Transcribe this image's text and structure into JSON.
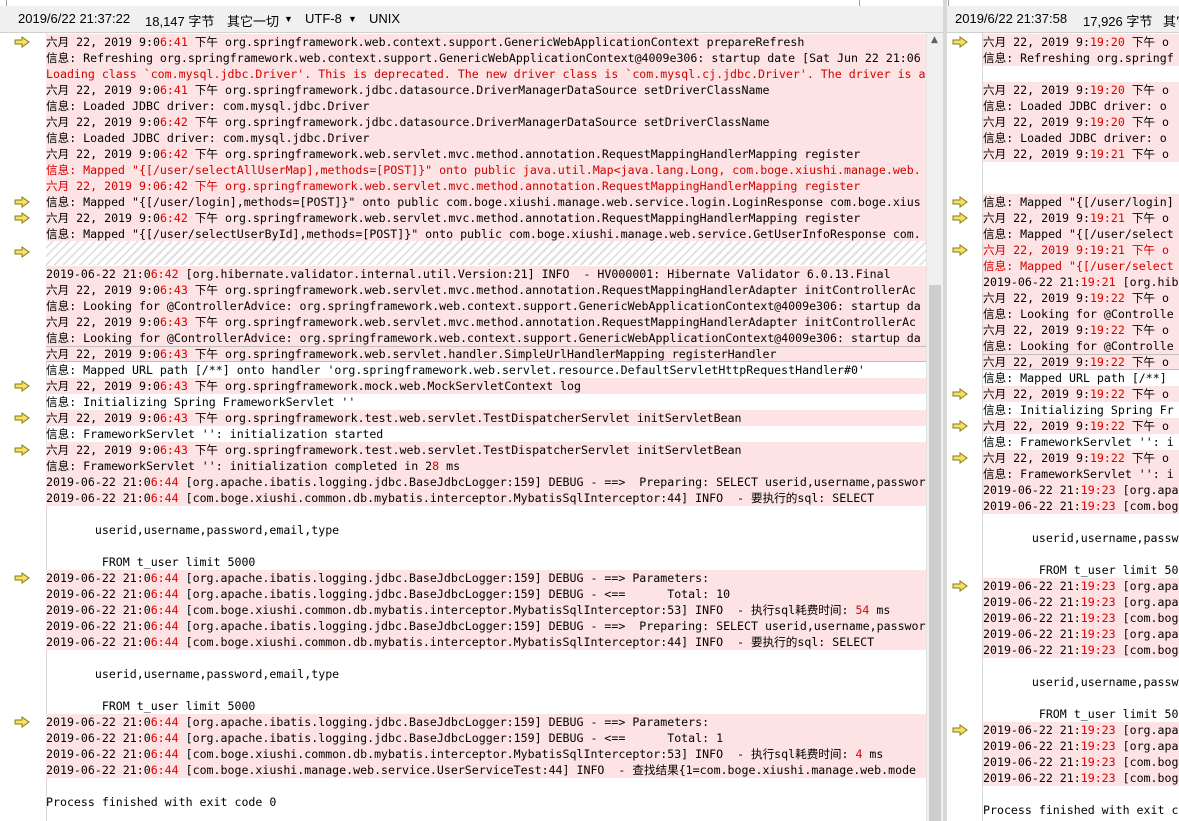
{
  "left": {
    "status": {
      "datetime": "2019/6/22 21:37:22",
      "size": "18,147 字节",
      "format": "其它一切",
      "encoding": "UTF-8",
      "eol": "UNIX"
    },
    "lines": [
      {
        "pre": "六月 22, 2019 9:0",
        "hl": "6:41",
        "post": " 下午 org.springframework.web.context.support.GenericWebApplicationContext prepareRefresh",
        "red": false,
        "arrow": true
      },
      {
        "pre": "信息: Refreshing org.springframework.web.context.support.GenericWebApplicationContext@4009e306: startup date [Sat Jun 22 21:06",
        "hl": "",
        "post": "",
        "red": false,
        "arrow": false
      },
      {
        "pre": "Loading class `com.mysql.jdbc.Driver'. This is deprecated. The new driver class is `com.mysql.cj.jdbc.Driver'. The driver is a",
        "hl": "",
        "post": "",
        "red": true,
        "arrow": false
      },
      {
        "pre": "六月 22, 2019 9:0",
        "hl": "6:41",
        "post": " 下午 org.springframework.jdbc.datasource.DriverManagerDataSource setDriverClassName",
        "red": false,
        "arrow": false
      },
      {
        "pre": "信息: Loaded JDBC driver: com.mysql.jdbc.Driver",
        "hl": "",
        "post": "",
        "red": false,
        "arrow": false
      },
      {
        "pre": "六月 22, 2019 9:0",
        "hl": "6:42",
        "post": " 下午 org.springframework.jdbc.datasource.DriverManagerDataSource setDriverClassName",
        "red": false,
        "arrow": false
      },
      {
        "pre": "信息: Loaded JDBC driver: com.mysql.jdbc.Driver",
        "hl": "",
        "post": "",
        "red": false,
        "arrow": false
      },
      {
        "pre": "六月 22, 2019 9:0",
        "hl": "6:42",
        "post": " 下午 org.springframework.web.servlet.mvc.method.annotation.RequestMappingHandlerMapping register",
        "red": false,
        "arrow": false
      },
      {
        "pre": "信息: Mapped \"{[/user/selectAllUserMap],methods=[POST]}\" onto public java.util.Map<java.lang.Long, com.boge.xiushi.manage.web.",
        "hl": "",
        "post": "",
        "red": true,
        "arrow": false
      },
      {
        "pre": "六月 22, 2019 9:06:42 下午 org.springframework.web.servlet.mvc.method.annotation.RequestMappingHandlerMapping register",
        "hl": "",
        "post": "",
        "red": true,
        "arrow": false
      },
      {
        "pre": "信息: Mapped \"{[/user/login],methods=[POST]}\" onto public com.boge.xiushi.manage.web.service.login.LoginResponse com.boge.xius",
        "hl": "",
        "post": "",
        "red": false,
        "arrow": true
      },
      {
        "pre": "六月 22, 2019 9:0",
        "hl": "6:42",
        "post": " 下午 org.springframework.web.servlet.mvc.method.annotation.RequestMappingHandlerMapping register",
        "red": false,
        "arrow": true
      },
      {
        "pre": "信息: Mapped \"{[/user/selectUserById],methods=[POST]}\" onto public com.boge.xiushi.manage.web.service.GetUserInfoResponse com.",
        "hl": "",
        "post": "",
        "red": false,
        "arrow": false
      },
      {
        "pre": "",
        "hl": "",
        "post": "",
        "red": false,
        "arrow": true,
        "hatch": true
      },
      {
        "pre": "2019-06-22 21:0",
        "hl": "6:42",
        "post": " [org.hibernate.validator.internal.util.Version:21] INFO  - HV000001: Hibernate Validator 6.0.13.Final",
        "red": false,
        "arrow": false
      },
      {
        "pre": "六月 22, 2019 9:0",
        "hl": "6:43",
        "post": " 下午 org.springframework.web.servlet.mvc.method.annotation.RequestMappingHandlerAdapter initControllerAc",
        "red": false,
        "arrow": false
      },
      {
        "pre": "信息: Looking for @ControllerAdvice: org.springframework.web.context.support.GenericWebApplicationContext@4009e306: startup da",
        "hl": "",
        "post": "",
        "red": false,
        "arrow": false
      },
      {
        "pre": "六月 22, 2019 9:0",
        "hl": "6:43",
        "post": " 下午 org.springframework.web.servlet.mvc.method.annotation.RequestMappingHandlerAdapter initControllerAc",
        "red": false,
        "arrow": false
      },
      {
        "pre": "信息: Looking for @ControllerAdvice: org.springframework.web.context.support.GenericWebApplicationContext@4009e306: startup da",
        "hl": "",
        "post": "",
        "red": false,
        "arrow": false
      },
      {
        "pre": "六月 22, 2019 9:0",
        "hl": "6:43",
        "post": " 下午 org.springframework.web.servlet.handler.SimpleUrlHandlerMapping registerHandler",
        "red": false,
        "arrow": false,
        "box": true
      },
      {
        "pre": "信息: Mapped URL path [/**] onto handler 'org.springframework.web.servlet.resource.DefaultServletHttpRequestHandler#0'",
        "hl": "",
        "post": "",
        "red": false,
        "arrow": false,
        "plain": true
      },
      {
        "pre": "六月 22, 2019 9:0",
        "hl": "6:43",
        "post": " 下午 org.springframework.mock.web.MockServletContext log",
        "red": false,
        "arrow": true
      },
      {
        "pre": "信息: Initializing Spring FrameworkServlet ''",
        "hl": "",
        "post": "",
        "red": false,
        "arrow": false,
        "plain": true
      },
      {
        "pre": "六月 22, 2019 9:0",
        "hl": "6:43",
        "post": " 下午 org.springframework.test.web.servlet.TestDispatcherServlet initServletBean",
        "red": false,
        "arrow": true
      },
      {
        "pre": "信息: FrameworkServlet '': initialization started",
        "hl": "",
        "post": "",
        "red": false,
        "arrow": false,
        "plain": true
      },
      {
        "pre": "六月 22, 2019 9:0",
        "hl": "6:43",
        "post": " 下午 org.springframework.test.web.servlet.TestDispatcherServlet initServletBean",
        "red": false,
        "arrow": true
      },
      {
        "pre": "信息: FrameworkServlet '': initialization completed in 2",
        "hl": "8",
        "post": " ms",
        "red": false,
        "arrow": false
      },
      {
        "pre": "2019-06-22 21:0",
        "hl": "6:44",
        "post": " [org.apache.ibatis.logging.jdbc.BaseJdbcLogger:159] DEBUG - ==>  Preparing: SELECT userid,username,passwor",
        "red": false,
        "arrow": false
      },
      {
        "pre": "2019-06-22 21:0",
        "hl": "6:44",
        "post": " [com.boge.xiushi.common.db.mybatis.interceptor.MybatisSqlInterceptor:44] INFO  - 要执行的sql: SELECT",
        "red": false,
        "arrow": false
      },
      {
        "pre": "",
        "hl": "",
        "post": "",
        "red": false,
        "arrow": false,
        "plain": true
      },
      {
        "pre": "       userid,username,password,email,type",
        "hl": "",
        "post": "",
        "red": false,
        "arrow": false,
        "plain": true
      },
      {
        "pre": "",
        "hl": "",
        "post": "",
        "red": false,
        "arrow": false,
        "plain": true
      },
      {
        "pre": "        FROM t_user limit 5000",
        "hl": "",
        "post": "",
        "red": false,
        "arrow": false,
        "plain": true
      },
      {
        "pre": "2019-06-22 21:0",
        "hl": "6:44",
        "post": " [org.apache.ibatis.logging.jdbc.BaseJdbcLogger:159] DEBUG - ==> Parameters: ",
        "red": false,
        "arrow": true
      },
      {
        "pre": "2019-06-22 21:0",
        "hl": "6:44",
        "post": " [org.apache.ibatis.logging.jdbc.BaseJdbcLogger:159] DEBUG - <==      Total: 10",
        "red": false,
        "arrow": false
      },
      {
        "pre": "2019-06-22 21:0",
        "hl": "6:44",
        "post": " [com.boge.xiushi.common.db.mybatis.interceptor.MybatisSqlInterceptor:53] INFO  - 执行sql耗费时间: ",
        "hl2": "54",
        "post2": " ms",
        "red": false,
        "arrow": false
      },
      {
        "pre": "2019-06-22 21:0",
        "hl": "6:44",
        "post": " [org.apache.ibatis.logging.jdbc.BaseJdbcLogger:159] DEBUG - ==>  Preparing: SELECT userid,username,passwor",
        "red": false,
        "arrow": false
      },
      {
        "pre": "2019-06-22 21:0",
        "hl": "6:44",
        "post": " [com.boge.xiushi.common.db.mybatis.interceptor.MybatisSqlInterceptor:44] INFO  - 要执行的sql: SELECT",
        "red": false,
        "arrow": false
      },
      {
        "pre": "",
        "hl": "",
        "post": "",
        "red": false,
        "arrow": false,
        "plain": true
      },
      {
        "pre": "       userid,username,password,email,type",
        "hl": "",
        "post": "",
        "red": false,
        "arrow": false,
        "plain": true
      },
      {
        "pre": "",
        "hl": "",
        "post": "",
        "red": false,
        "arrow": false,
        "plain": true
      },
      {
        "pre": "        FROM t_user limit 5000",
        "hl": "",
        "post": "",
        "red": false,
        "arrow": false,
        "plain": true
      },
      {
        "pre": "2019-06-22 21:0",
        "hl": "6:44",
        "post": " [org.apache.ibatis.logging.jdbc.BaseJdbcLogger:159] DEBUG - ==> Parameters: ",
        "red": false,
        "arrow": true
      },
      {
        "pre": "2019-06-22 21:0",
        "hl": "6:44",
        "post": " [org.apache.ibatis.logging.jdbc.BaseJdbcLogger:159] DEBUG - <==      Total: 1",
        "red": false,
        "arrow": false
      },
      {
        "pre": "2019-06-22 21:0",
        "hl": "6:44",
        "post": " [com.boge.xiushi.common.db.mybatis.interceptor.MybatisSqlInterceptor:53] INFO  - 执行sql耗费时间: ",
        "hl2": "4",
        "post2": " ms",
        "red": false,
        "arrow": false
      },
      {
        "pre": "2019-06-22 21:0",
        "hl": "6:44",
        "post": " [com.boge.xiushi.manage.web.service.UserServiceTest:44] INFO  - 查找结果{1=com.boge.xiushi.manage.web.mode",
        "red": false,
        "arrow": false
      },
      {
        "pre": "",
        "hl": "",
        "post": "",
        "red": false,
        "arrow": false,
        "plain": true
      },
      {
        "pre": "Process finished with exit code 0",
        "hl": "",
        "post": "",
        "red": false,
        "arrow": false,
        "plain": true
      }
    ]
  },
  "right": {
    "status": {
      "datetime": "2019/6/22 21:37:58",
      "size": "17,926 字节",
      "format": "其它"
    },
    "lines": [
      {
        "pre": "六月 22, 2019 9:",
        "hl": "19:20",
        "post": " 下午 o",
        "red": false,
        "arrow": true
      },
      {
        "pre": "信息: Refreshing org.springf",
        "hl": "",
        "post": "",
        "red": false,
        "arrow": false
      },
      {
        "pre": "",
        "hl": "",
        "post": "",
        "red": false,
        "arrow": false,
        "plain": true
      },
      {
        "pre": "六月 22, 2019 9:",
        "hl": "19:20",
        "post": " 下午 o",
        "red": false,
        "arrow": false
      },
      {
        "pre": "信息: Loaded JDBC driver: o",
        "hl": "",
        "post": "",
        "red": false,
        "arrow": false
      },
      {
        "pre": "六月 22, 2019 9:",
        "hl": "19:20",
        "post": " 下午 o",
        "red": false,
        "arrow": false
      },
      {
        "pre": "信息: Loaded JDBC driver: o",
        "hl": "",
        "post": "",
        "red": false,
        "arrow": false
      },
      {
        "pre": "六月 22, 2019 9:",
        "hl": "19:21",
        "post": " 下午 o",
        "red": false,
        "arrow": false
      },
      {
        "pre": "",
        "hl": "",
        "post": "",
        "red": false,
        "arrow": false,
        "hatch2": true
      },
      {
        "pre": "",
        "hl": "",
        "post": "",
        "red": false,
        "arrow": false,
        "hatch2": true
      },
      {
        "pre": "信息: Mapped \"{[/user/login]",
        "hl": "",
        "post": "",
        "red": false,
        "arrow": true
      },
      {
        "pre": "六月 22, 2019 9:",
        "hl": "19:21",
        "post": " 下午 o",
        "red": false,
        "arrow": true
      },
      {
        "pre": "信息: Mapped \"{[/user/select",
        "hl": "",
        "post": "",
        "red": false,
        "arrow": false
      },
      {
        "pre": "六月 22, 2019 9:19:21 下午 o",
        "hl": "",
        "post": "",
        "red": true,
        "arrow": true
      },
      {
        "pre": "信息: Mapped \"{[/user/select",
        "hl": "",
        "post": "",
        "red": true,
        "arrow": false
      },
      {
        "pre": "2019-06-22 21:",
        "hl": "19:21",
        "post": " [org.hib",
        "red": false,
        "arrow": false
      },
      {
        "pre": "六月 22, 2019 9:",
        "hl": "19:22",
        "post": " 下午 o",
        "red": false,
        "arrow": false
      },
      {
        "pre": "信息: Looking for @Controlle",
        "hl": "",
        "post": "",
        "red": false,
        "arrow": false
      },
      {
        "pre": "六月 22, 2019 9:",
        "hl": "19:22",
        "post": " 下午 o",
        "red": false,
        "arrow": false
      },
      {
        "pre": "信息: Looking for @Controlle",
        "hl": "",
        "post": "",
        "red": false,
        "arrow": false
      },
      {
        "pre": "六月 22, 2019 9:",
        "hl": "19:22",
        "post": " 下午 o",
        "red": false,
        "arrow": false,
        "box": true
      },
      {
        "pre": "信息: Mapped URL path [/**]",
        "hl": "",
        "post": "",
        "red": false,
        "arrow": false,
        "plain": true
      },
      {
        "pre": "六月 22, 2019 9:",
        "hl": "19:22",
        "post": " 下午 o",
        "red": false,
        "arrow": true
      },
      {
        "pre": "信息: Initializing Spring Fr",
        "hl": "",
        "post": "",
        "red": false,
        "arrow": false,
        "plain": true
      },
      {
        "pre": "六月 22, 2019 9:",
        "hl": "19:22",
        "post": " 下午 o",
        "red": false,
        "arrow": true
      },
      {
        "pre": "信息: FrameworkServlet '': i",
        "hl": "",
        "post": "",
        "red": false,
        "arrow": false,
        "plain": true
      },
      {
        "pre": "六月 22, 2019 9:",
        "hl": "19:22",
        "post": " 下午 o",
        "red": false,
        "arrow": true
      },
      {
        "pre": "信息: FrameworkServlet '': i",
        "hl": "",
        "post": "",
        "red": false,
        "arrow": false
      },
      {
        "pre": "2019-06-22 21:",
        "hl": "19:23",
        "post": " [org.apa",
        "red": false,
        "arrow": false
      },
      {
        "pre": "2019-06-22 21:",
        "hl": "19:23",
        "post": " [com.bog",
        "red": false,
        "arrow": false
      },
      {
        "pre": "",
        "hl": "",
        "post": "",
        "red": false,
        "arrow": false,
        "plain": true
      },
      {
        "pre": "       userid,username,passw",
        "hl": "",
        "post": "",
        "red": false,
        "arrow": false,
        "plain": true
      },
      {
        "pre": "",
        "hl": "",
        "post": "",
        "red": false,
        "arrow": false,
        "plain": true
      },
      {
        "pre": "        FROM t_user limit 50",
        "hl": "",
        "post": "",
        "red": false,
        "arrow": false,
        "plain": true
      },
      {
        "pre": "2019-06-22 21:",
        "hl": "19:23",
        "post": " [org.apa",
        "red": false,
        "arrow": true
      },
      {
        "pre": "2019-06-22 21:",
        "hl": "19:23",
        "post": " [org.apa",
        "red": false,
        "arrow": false
      },
      {
        "pre": "2019-06-22 21:",
        "hl": "19:23",
        "post": " [com.bog",
        "red": false,
        "arrow": false
      },
      {
        "pre": "2019-06-22 21:",
        "hl": "19:23",
        "post": " [org.apa",
        "red": false,
        "arrow": false
      },
      {
        "pre": "2019-06-22 21:",
        "hl": "19:23",
        "post": " [com.bog",
        "red": false,
        "arrow": false
      },
      {
        "pre": "",
        "hl": "",
        "post": "",
        "red": false,
        "arrow": false,
        "plain": true
      },
      {
        "pre": "       userid,username,passw",
        "hl": "",
        "post": "",
        "red": false,
        "arrow": false,
        "plain": true
      },
      {
        "pre": "",
        "hl": "",
        "post": "",
        "red": false,
        "arrow": false,
        "plain": true
      },
      {
        "pre": "        FROM t_user limit 50",
        "hl": "",
        "post": "",
        "red": false,
        "arrow": false,
        "plain": true
      },
      {
        "pre": "2019-06-22 21:",
        "hl": "19:23",
        "post": " [org.apa",
        "red": false,
        "arrow": true
      },
      {
        "pre": "2019-06-22 21:",
        "hl": "19:23",
        "post": " [org.apa",
        "red": false,
        "arrow": false
      },
      {
        "pre": "2019-06-22 21:",
        "hl": "19:23",
        "post": " [com.bog",
        "red": false,
        "arrow": false
      },
      {
        "pre": "2019-06-22 21:",
        "hl": "19:23",
        "post": " [com.bog",
        "red": false,
        "arrow": false
      },
      {
        "pre": "",
        "hl": "",
        "post": "",
        "red": false,
        "arrow": false,
        "plain": true
      },
      {
        "pre": "Process finished with exit c",
        "hl": "",
        "post": "",
        "red": false,
        "arrow": false,
        "plain": true
      }
    ]
  },
  "colors": {
    "diff_bg": "#fde3e3",
    "highlight": "#e00000",
    "marker_fill": "#f2e36a",
    "marker_stroke": "#8a7a10"
  }
}
